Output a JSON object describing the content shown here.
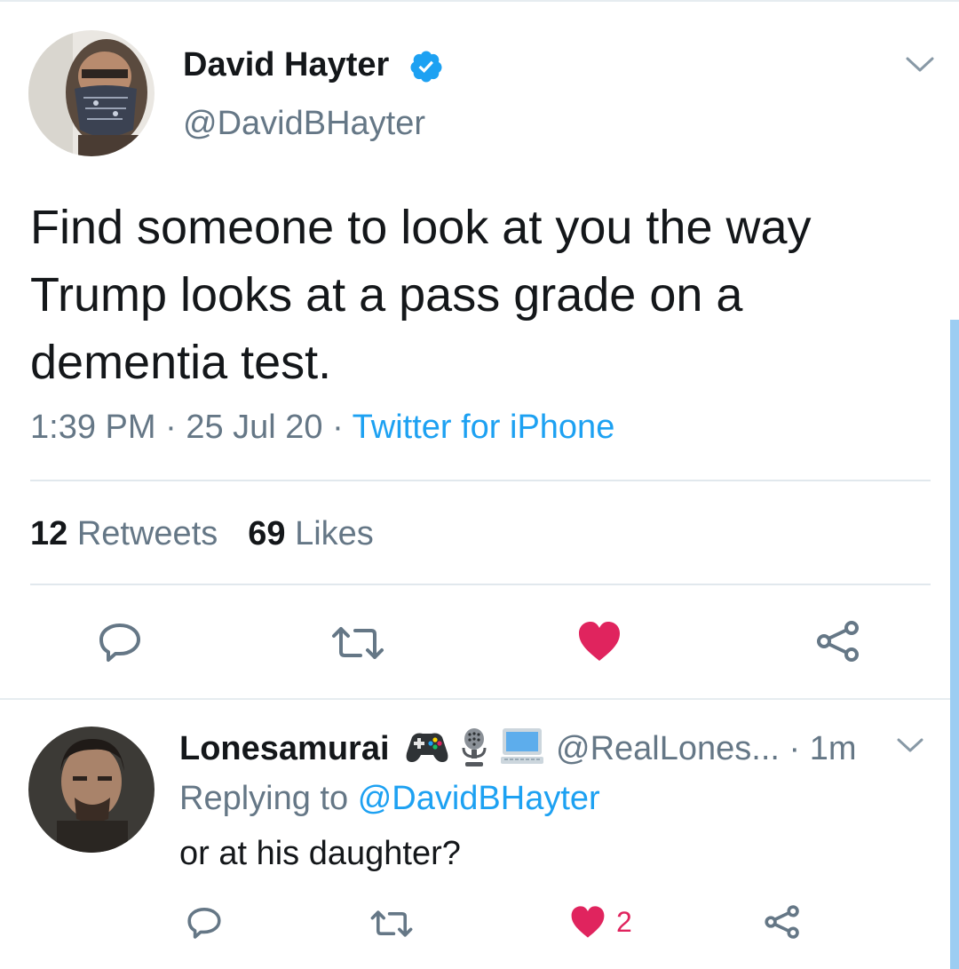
{
  "tweet": {
    "author_name": "David Hayter",
    "author_handle": "@DavidBHayter",
    "text": "Find someone to look at you the way Trump looks at a pass grade on a dementia test.",
    "time": "1:39 PM",
    "date": "25 Jul 20",
    "source": "Twitter for iPhone",
    "sep": " · ",
    "retweets_count": "12",
    "retweets_label": "Retweets",
    "likes_count": "69",
    "likes_label": "Likes",
    "liked": true
  },
  "reply": {
    "author_name": "Lonesamurai",
    "author_handle": "@RealLones...",
    "time_sep": " · ",
    "time": "1m",
    "replying_prefix": "Replying to",
    "replying_to": "@DavidBHayter",
    "text": "or at his daughter?",
    "like_count": "2",
    "name_emojis": [
      "game-controller-icon",
      "microphone-icon",
      "computer-icon"
    ]
  },
  "colors": {
    "accent": "#1da1f2",
    "like": "#e0245e",
    "secondary_text": "#657786",
    "icon_gray": "#657786",
    "scrollbar": "#9ccdf2"
  }
}
